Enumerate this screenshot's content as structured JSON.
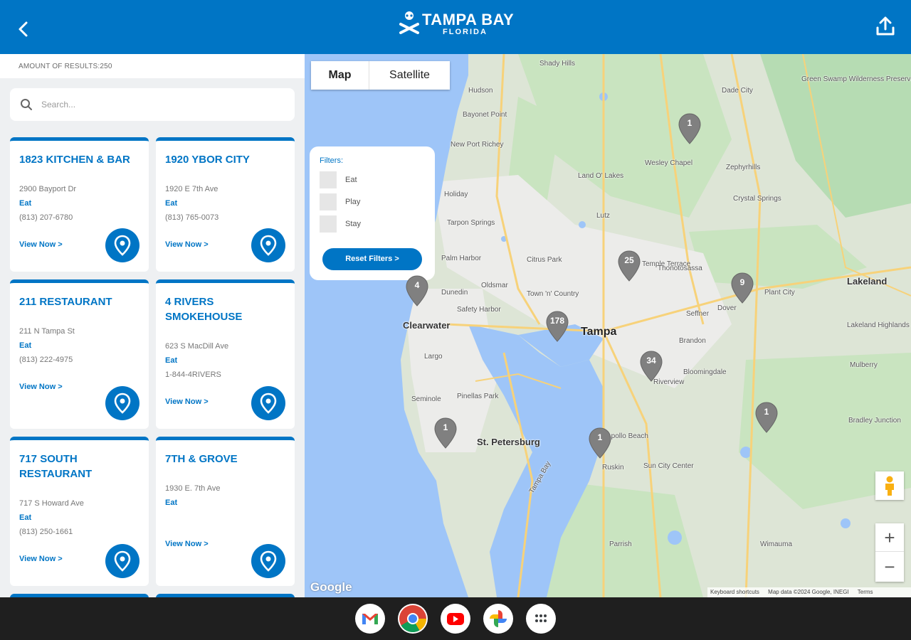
{
  "header": {
    "logo_title": "TAMPA BAY",
    "logo_subtitle": "FLORIDA"
  },
  "results": {
    "label": "AMOUNT OF RESULTS:250"
  },
  "search": {
    "placeholder": "Search..."
  },
  "listings": [
    {
      "name": "1823 KITCHEN & BAR",
      "address": "2900 Bayport Dr",
      "category": "Eat",
      "phone": "(813) 207-6780",
      "cta": "View Now >"
    },
    {
      "name": "1920 YBOR CITY",
      "address": "1920 E 7th Ave",
      "category": "Eat",
      "phone": "(813) 765-0073",
      "cta": "View Now >"
    },
    {
      "name": "211 RESTAURANT",
      "address": "211 N Tampa St",
      "category": "Eat",
      "phone": "(813) 222-4975",
      "cta": "View Now >"
    },
    {
      "name": "4 RIVERS SMOKEHOUSE",
      "address": "623 S MacDill Ave",
      "category": "Eat",
      "phone": "1-844-4RIVERS",
      "cta": "View Now >"
    },
    {
      "name": "717 SOUTH RESTAURANT",
      "address": "717 S Howard Ave",
      "category": "Eat",
      "phone": "(813) 250-1661",
      "cta": "View Now >"
    },
    {
      "name": "7TH & GROVE",
      "address": "1930 E. 7th Ave",
      "category": "Eat",
      "phone": "",
      "cta": "View Now >"
    }
  ],
  "map": {
    "type_options": [
      "Map",
      "Satellite"
    ],
    "filters": {
      "title": "Filters:",
      "options": [
        "Eat",
        "Play",
        "Stay"
      ],
      "reset_label": "Reset Filters >"
    },
    "clusters": [
      "1",
      "25",
      "9",
      "4",
      "178",
      "34",
      "1",
      "1",
      "1"
    ],
    "labels": {
      "tampa": "Tampa",
      "st_petersburg": "St. Petersburg",
      "clearwater": "Clearwater",
      "lakeland": "Lakeland",
      "shady_hills": "Shady Hills",
      "hudson": "Hudson",
      "bayonet_point": "Bayonet Point",
      "new_port_richey": "New Port Richey",
      "holiday": "Holiday",
      "tarpon_springs": "Tarpon Springs",
      "palm_harbor": "Palm Harbor",
      "dunedin": "Dunedin",
      "oldsmar": "Oldsmar",
      "safety_harbor": "Safety Harbor",
      "largo": "Largo",
      "seminole": "Seminole",
      "pinellas_park": "Pinellas Park",
      "land_o_lakes": "Land O' Lakes",
      "lutz": "Lutz",
      "wesley_chapel": "Wesley Chapel",
      "zephyrhills": "Zephyrhills",
      "crystal_springs": "Crystal Springs",
      "dade_city": "Dade City",
      "thonotosassa": "Thonotosassa",
      "plant_city": "Plant City",
      "brandon": "Brandon",
      "seffner": "Seffner",
      "dover": "Dover",
      "riverview": "Riverview",
      "bloomingdale": "Bloomingdale",
      "apollo_beach": "Apollo Beach",
      "ruskin": "Ruskin",
      "sun_city_center": "Sun City Center",
      "parrish": "Parrish",
      "wimauma": "Wimauma",
      "lakeland_highlands": "Lakeland Highlands",
      "mulberry": "Mulberry",
      "bradley_junction": "Bradley Junction",
      "green_swamp": "Green Swamp Wilderness Preserve",
      "citrus_park": "Citrus Park",
      "town_n_country": "Town 'n' Country",
      "temple_terrace": "Temple Terrace",
      "tampa_bay": "Tampa Bay",
      "keyboard_shortcuts": "Keyboard shortcuts",
      "map_data": "Map data ©2024 Google, INEGI",
      "terms": "Terms",
      "google": "Google"
    }
  },
  "colors": {
    "brand": "#0075c5",
    "map_water": "#9ec5f8",
    "map_land": "#dde5d6",
    "map_park": "#b6dcb3"
  }
}
